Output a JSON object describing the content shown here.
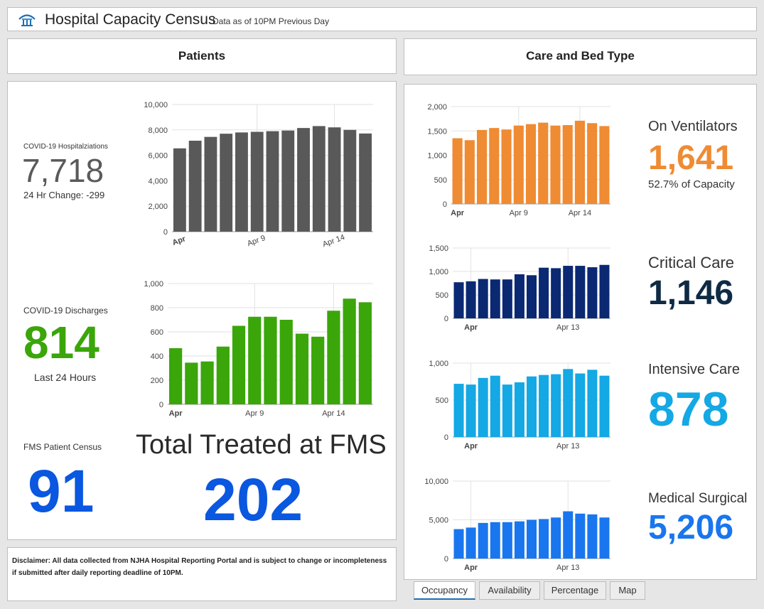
{
  "header": {
    "title": "Hospital Capacity Census",
    "subtitle": "Data as of 10PM Previous Day"
  },
  "sections": {
    "patients": "Patients",
    "care": "Care and Bed Type"
  },
  "colors": {
    "gray": "#595959",
    "green": "#3aa60a",
    "orange": "#ef8b33",
    "navy": "#0b2873",
    "cyan": "#14a8e4",
    "blue": "#1976ee",
    "bigBlue": "#0a57e0",
    "darkNum": "#0f2a45"
  },
  "patients": {
    "hosp": {
      "label": "COVID-19 Hospitalziations",
      "value": "7,718",
      "change": "24 Hr Change: -299"
    },
    "disch": {
      "label": "COVID-19 Discharges",
      "value": "814",
      "sub": "Last 24 Hours"
    },
    "fms": {
      "label": "FMS Patient Census",
      "value": "91"
    },
    "total": {
      "label": "Total Treated at FMS",
      "value": "202"
    }
  },
  "care": {
    "vent": {
      "label": "On Ventilators",
      "value": "1,641",
      "sub": "52.7% of Capacity"
    },
    "crit": {
      "label": "Critical Care",
      "value": "1,146"
    },
    "icu": {
      "label": "Intensive Care",
      "value": "878"
    },
    "med": {
      "label": "Medical Surgical",
      "value": "5,206"
    }
  },
  "disclaimer": "Disclaimer:  All data collected from NJHA Hospital Reporting Portal and is subject to change or incompleteness if submitted after daily reporting deadline of 10PM.",
  "tabs": [
    "Occupancy",
    "Availability",
    "Percentage",
    "Map"
  ],
  "chart_data": [
    {
      "id": "hosp",
      "type": "bar",
      "color": "#595959",
      "rotated_x": true,
      "values": [
        6550,
        7150,
        7450,
        7700,
        7800,
        7850,
        7900,
        7950,
        8150,
        8300,
        8200,
        8000,
        7718
      ],
      "ylim": [
        0,
        10000
      ],
      "yticks": [
        "0",
        "2,000",
        "4,000",
        "6,000",
        "8,000",
        "10,000"
      ],
      "xticks": [
        {
          "i": 0,
          "label": "Apr"
        },
        {
          "i": 5,
          "label": "Apr 9"
        },
        {
          "i": 10,
          "label": "Apr 14"
        }
      ]
    },
    {
      "id": "disch",
      "type": "bar",
      "color": "#3aa60a",
      "values": [
        465,
        345,
        355,
        478,
        650,
        725,
        725,
        700,
        585,
        560,
        775,
        875,
        845
      ],
      "ylim": [
        0,
        1000
      ],
      "yticks": [
        "0",
        "200",
        "400",
        "600",
        "800",
        "1,000"
      ],
      "xticks": [
        {
          "i": 0,
          "label": "Apr"
        },
        {
          "i": 5,
          "label": "Apr 9"
        },
        {
          "i": 10,
          "label": "Apr 14"
        }
      ]
    },
    {
      "id": "vent",
      "type": "bar",
      "color": "#ef8b33",
      "values": [
        1350,
        1310,
        1520,
        1560,
        1530,
        1610,
        1640,
        1670,
        1610,
        1620,
        1710,
        1660,
        1600
      ],
      "ylim": [
        0,
        2000
      ],
      "yticks": [
        "0",
        "500",
        "1,000",
        "1,500",
        "2,000"
      ],
      "xticks": [
        {
          "i": 0,
          "label": "Apr"
        },
        {
          "i": 5,
          "label": "Apr 9"
        },
        {
          "i": 10,
          "label": "Apr 14"
        }
      ]
    },
    {
      "id": "crit",
      "type": "bar",
      "color": "#0b2873",
      "values": [
        770,
        790,
        840,
        830,
        830,
        940,
        920,
        1080,
        1070,
        1120,
        1120,
        1090,
        1140
      ],
      "ylim": [
        0,
        1500
      ],
      "yticks": [
        "0",
        "500",
        "1,000",
        "1,500"
      ],
      "xticks": [
        {
          "i": 1,
          "label": "Apr"
        },
        {
          "i": 9,
          "label": "Apr 13"
        }
      ]
    },
    {
      "id": "icu",
      "type": "bar",
      "color": "#14a8e4",
      "values": [
        720,
        710,
        800,
        830,
        710,
        740,
        820,
        840,
        850,
        920,
        860,
        910,
        830
      ],
      "ylim": [
        0,
        1000
      ],
      "yticks": [
        "0",
        "500",
        "1,000"
      ],
      "xticks": [
        {
          "i": 1,
          "label": "Apr"
        },
        {
          "i": 9,
          "label": "Apr 13"
        }
      ]
    },
    {
      "id": "med",
      "type": "bar",
      "color": "#1976ee",
      "values": [
        3800,
        4000,
        4600,
        4700,
        4700,
        4800,
        5000,
        5100,
        5300,
        6100,
        5800,
        5700,
        5300
      ],
      "ylim": [
        0,
        10000
      ],
      "yticks": [
        "0",
        "5,000",
        "10,000"
      ],
      "xticks": [
        {
          "i": 1,
          "label": "Apr"
        },
        {
          "i": 9,
          "label": "Apr 13"
        }
      ]
    }
  ]
}
